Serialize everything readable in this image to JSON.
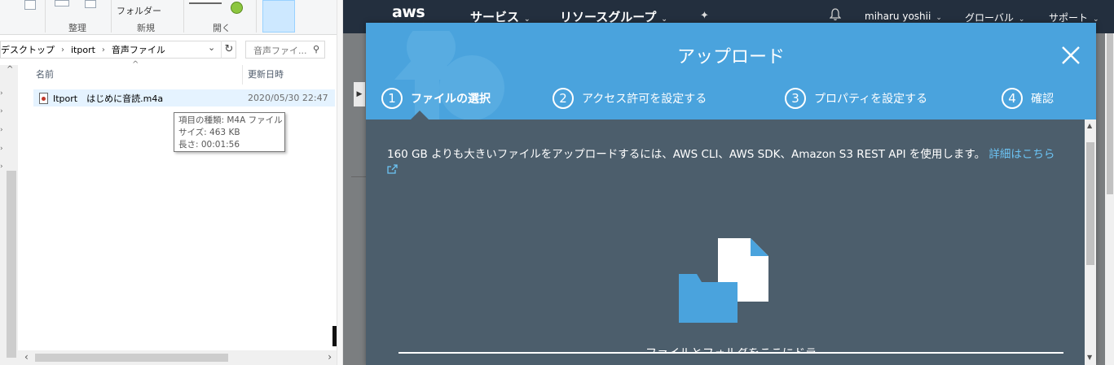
{
  "explorer": {
    "ribbon": {
      "folder_button_label": "フォルダー",
      "group_organize": "整理",
      "group_new": "新規",
      "group_open": "開く"
    },
    "address": {
      "crumbs": [
        "デスクトップ",
        "itport",
        "音声ファイル"
      ]
    },
    "search": {
      "placeholder": "音声ファイ..."
    },
    "columns": {
      "name": "名前",
      "date_modified": "更新日時"
    },
    "files": [
      {
        "name": "Itport　はじめに音読.m4a",
        "date": "2020/05/30 22:47"
      }
    ],
    "tooltip": {
      "type": "項目の種類: M4A ファイル",
      "size": "サイズ: 463 KB",
      "length": "長さ: 00:01:56"
    }
  },
  "aws": {
    "logo": "aws",
    "nav": {
      "services": "サービス",
      "resource_groups": "リソースグループ",
      "user": "miharu yoshii",
      "region": "グローバル",
      "support": "サポート"
    },
    "modal": {
      "title": "アップロード",
      "steps": [
        {
          "num": "1",
          "label": "ファイルの選択",
          "active": true
        },
        {
          "num": "2",
          "label": "アクセス許可を設定する",
          "active": false
        },
        {
          "num": "3",
          "label": "プロパティを設定する",
          "active": false
        },
        {
          "num": "4",
          "label": "確認",
          "active": false
        }
      ],
      "info_text": "160 GB よりも大きいファイルをアップロードするには、AWS CLI、AWS SDK、Amazon S3 REST API を使用します。",
      "info_link": "詳細はこちら",
      "drop_text": "ファイルとフォルダをここにドラ"
    },
    "colors": {
      "nav_bg": "#232f3e",
      "modal_header": "#4aa3dd",
      "modal_body": "#4c5e6c",
      "link": "#6cc4f5",
      "brand_orange": "#ff9900"
    }
  }
}
